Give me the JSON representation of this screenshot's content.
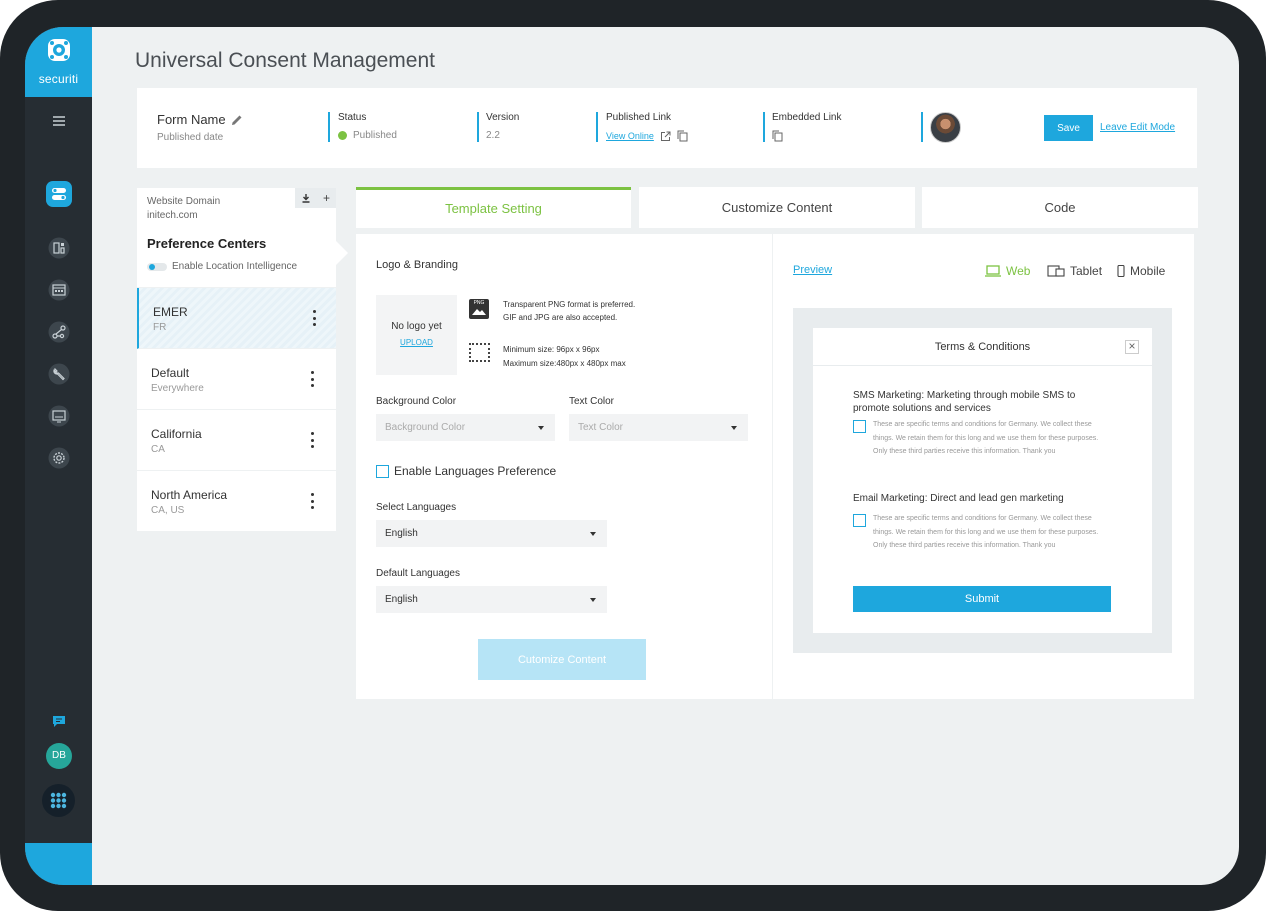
{
  "brand": {
    "name": "securiti",
    "color": "#1ea7dd"
  },
  "page": {
    "title": "Universal Consent Management"
  },
  "form_bar": {
    "form_name": "Form Name",
    "published_date": "Published date",
    "status_label": "Status",
    "status_value": "Published",
    "version_label": "Version",
    "version_value": "2.2",
    "published_link_label": "Published Link",
    "view_online": "View Online",
    "embedded_link_label": "Embedded Link",
    "save_label": "Save",
    "leave_edit_label": "Leave Edit Mode"
  },
  "sidebar": {
    "icons": [
      "menu-icon",
      "toggle-settings-icon",
      "dashboard-icon",
      "calendar-grid-icon",
      "workflow-icon",
      "wrench-icon",
      "monitor-icon",
      "gear-icon",
      "chat-icon"
    ],
    "user_initials": "DB"
  },
  "left_panel": {
    "domain_label": "Website Domain",
    "domain_value": "initech.com",
    "title": "Preference Centers",
    "toggle_label": "Enable Location Intelligence",
    "items": [
      {
        "name": "EMER",
        "sub": "FR"
      },
      {
        "name": "Default",
        "sub": "Everywhere"
      },
      {
        "name": "California",
        "sub": "CA"
      },
      {
        "name": "North America",
        "sub": "CA, US"
      }
    ]
  },
  "tabs": [
    {
      "label": "Template Setting"
    },
    {
      "label": "Customize Content"
    },
    {
      "label": "Code"
    }
  ],
  "template": {
    "logo_title": "Logo & Branding",
    "no_logo": "No logo yet",
    "upload": "UPLOAD",
    "png_badge": "PNG",
    "png_hint_1": "Transparent PNG format is preferred.",
    "png_hint_2": "GIF and JPG are also accepted.",
    "size_hint_1": "Minimum size: 96px x 96px",
    "size_hint_2": "Maximum size:480px x 480px max",
    "bg_color_label": "Background Color",
    "bg_color_placeholder": "Background Color",
    "text_color_label": "Text Color",
    "text_color_placeholder": "Text Color",
    "enable_languages": "Enable Languages Preference",
    "select_languages_label": "Select Languages",
    "select_languages_value": "English",
    "default_languages_label": "Default Languages",
    "default_languages_value": "English",
    "customize_btn": "Cutomize Content"
  },
  "preview": {
    "link": "Preview",
    "devices": [
      {
        "label": "Web",
        "icon": "laptop-icon",
        "active": true
      },
      {
        "label": "Tablet",
        "icon": "tablet-icon",
        "active": false
      },
      {
        "label": "Mobile",
        "icon": "mobile-icon",
        "active": false
      }
    ],
    "modal_title": "Terms & Conditions",
    "consents": [
      {
        "title": "SMS Marketing: Marketing through mobile SMS to promote solutions and services",
        "text": "These are specific terms and conditions for Germany. We collect these things. We retain them for this long and we use them for these purposes. Only these third parties receive this information. Thank you"
      },
      {
        "title": "Email Marketing: Direct and lead gen marketing",
        "text": "These are specific terms and conditions for Germany. We collect these things. We retain them for this long and we use them for these purposes. Only these third parties receive this information. Thank you"
      }
    ],
    "submit": "Submit"
  },
  "colors": {
    "accent": "#1ea7dd",
    "active_green": "#7cc242",
    "sidebar": "#262d33"
  }
}
